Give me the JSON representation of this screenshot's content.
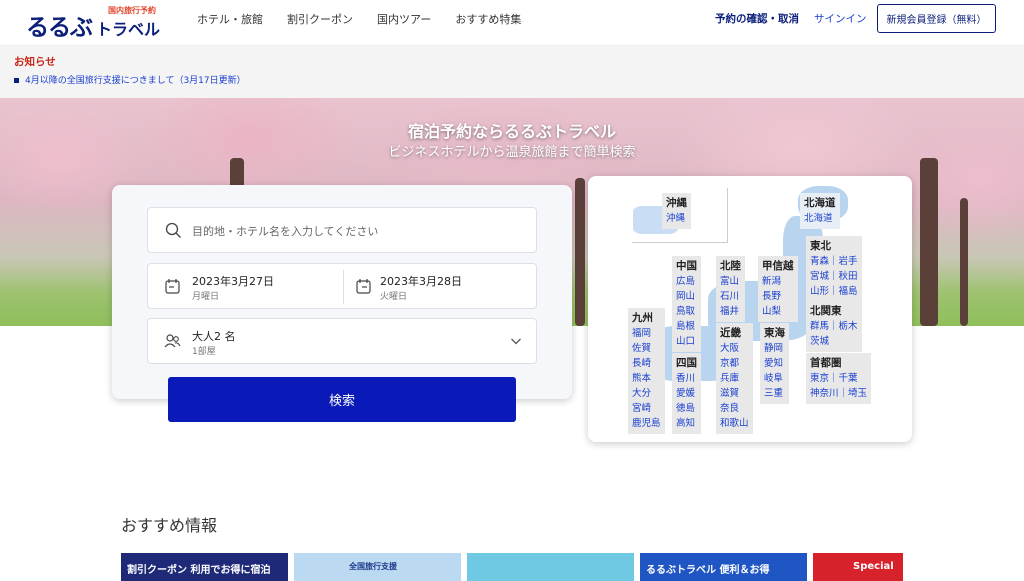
{
  "header": {
    "logo_main": "るるぶ",
    "logo_sub": "国内旅行予約",
    "logo_travel": "トラベル",
    "nav": [
      "ホテル・旅館",
      "割引クーポン",
      "国内ツアー",
      "おすすめ特集"
    ],
    "reserve_label": "予約の確認・取消",
    "signin_label": "サインイン",
    "register_label": "新規会員登録（無料）"
  },
  "notice": {
    "title": "お知らせ",
    "item": "4月以降の全国旅行支援につきまして（3月17日更新）"
  },
  "hero": {
    "title": "宿泊予約ならるるぶトラベル",
    "subtitle": "ビジネスホテルから温泉旅館まで簡単検索"
  },
  "search": {
    "destination_placeholder": "目的地・ホテル名を入力してください",
    "checkin_date": "2023年3月27日",
    "checkin_day": "月曜日",
    "checkout_date": "2023年3月28日",
    "checkout_day": "火曜日",
    "guests": "大人2 名",
    "rooms": "1部屋",
    "button_label": "検索"
  },
  "map": {
    "regions": {
      "okinawa": {
        "name": "沖縄",
        "prefs": [
          "沖縄"
        ]
      },
      "hokkaido": {
        "name": "北海道",
        "prefs": [
          "北海道"
        ]
      },
      "tohoku": {
        "name": "東北",
        "prefs": [
          "青森｜岩手",
          "宮城｜秋田",
          "山形｜福島"
        ]
      },
      "chugoku": {
        "name": "中国",
        "prefs": [
          "広島",
          "岡山",
          "鳥取",
          "島根",
          "山口"
        ]
      },
      "hokuriku": {
        "name": "北陸",
        "prefs": [
          "富山",
          "石川",
          "福井"
        ]
      },
      "koshinetsu": {
        "name": "甲信越",
        "prefs": [
          "新潟",
          "長野",
          "山梨"
        ]
      },
      "kitakanto": {
        "name": "北関東",
        "prefs": [
          "群馬｜栃木",
          "茨城"
        ]
      },
      "kyushu": {
        "name": "九州",
        "prefs": [
          "福岡",
          "佐賀",
          "長崎",
          "熊本",
          "大分",
          "宮崎",
          "鹿児島"
        ]
      },
      "kinki": {
        "name": "近畿",
        "prefs": [
          "大阪",
          "京都",
          "兵庫",
          "滋賀",
          "奈良",
          "和歌山"
        ]
      },
      "tokai": {
        "name": "東海",
        "prefs": [
          "静岡",
          "愛知",
          "岐阜",
          "三重"
        ]
      },
      "shikoku": {
        "name": "四国",
        "prefs": [
          "香川",
          "愛媛",
          "徳島",
          "高知"
        ]
      },
      "shutoken": {
        "name": "首都圏",
        "prefs": [
          "東京｜千葉",
          "神奈川｜埼玉"
        ]
      }
    }
  },
  "recommend": {
    "title": "おすすめ情報",
    "banners": [
      "割引クーポン 利用でお得に宿泊",
      "全国旅行支援",
      "",
      "るるぶトラベル 便利＆お得",
      "Special"
    ]
  },
  "colors": {
    "brand_navy": "#0b1f7a",
    "search_button": "#0a1ab8",
    "link_blue": "#1a3fd0",
    "notice_red": "#c52a1a"
  }
}
